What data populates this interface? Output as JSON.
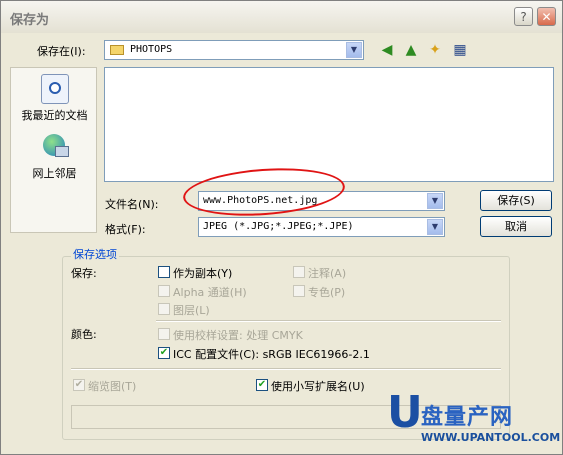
{
  "window": {
    "title": "保存为",
    "help_label": "?",
    "close_label": "✕"
  },
  "location": {
    "label": "保存在(I):",
    "value": "PHOTOPS"
  },
  "places": [
    {
      "label": "我最近的文档",
      "icon": "recent-documents-icon"
    },
    {
      "label": "网上邻居",
      "icon": "network-neighborhood-icon"
    }
  ],
  "file": {
    "name_label": "文件名(N):",
    "name_value": "www.PhotoPS.net.jpg",
    "format_label": "格式(F):",
    "format_value": "JPEG (*.JPG;*.JPEG;*.JPE)"
  },
  "buttons": {
    "save": "保存(S)",
    "cancel": "取消"
  },
  "options": {
    "group_title": "保存选项",
    "save_label": "保存:",
    "as_copy": "作为副本(Y)",
    "alpha": "Alpha 通道(H)",
    "layers": "图层(L)",
    "annotations": "注释(A)",
    "spot_colors": "专色(P)",
    "color_label": "颜色:",
    "proof_setup": "使用校样设置: 处理 CMYK",
    "icc_profile": "ICC 配置文件(C): sRGB IEC61966-2.1",
    "thumbnail": "缩览图(T)",
    "lowercase_ext": "使用小写扩展名(U)"
  },
  "watermark": {
    "brand": "盘量产网",
    "url": "WWW.UPANTOOL.COM"
  },
  "colors": {
    "annotation_red": "#e01414",
    "group_title_blue": "#0046d5"
  }
}
